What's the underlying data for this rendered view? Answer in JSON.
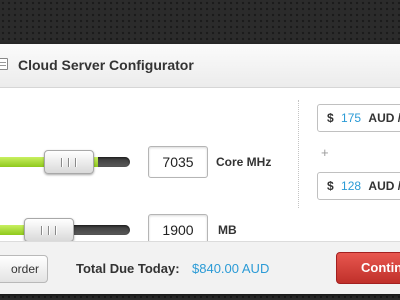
{
  "header": {
    "title": "Cloud Server Configurator"
  },
  "config": {
    "cpu": {
      "value": "7035",
      "unit": "Core MHz",
      "level": 0.8
    },
    "memory": {
      "value": "1900",
      "unit": "MB",
      "level": 0.45
    }
  },
  "pricing": {
    "cpu": {
      "currency": "$",
      "amount": "175",
      "code": "AUD /"
    },
    "plus": "+",
    "memory": {
      "currency": "$",
      "amount": "128",
      "code": "AUD /"
    }
  },
  "footer": {
    "order_label": "order",
    "total_label": "Total Due Today:",
    "total_value": "$840.00 AUD",
    "continue_label": "Contin"
  },
  "colors": {
    "accent_green": "#8fc91c",
    "price_blue": "#2b9bd6",
    "continue_red": "#c0302a"
  },
  "icons": {
    "header": "document-icon"
  }
}
